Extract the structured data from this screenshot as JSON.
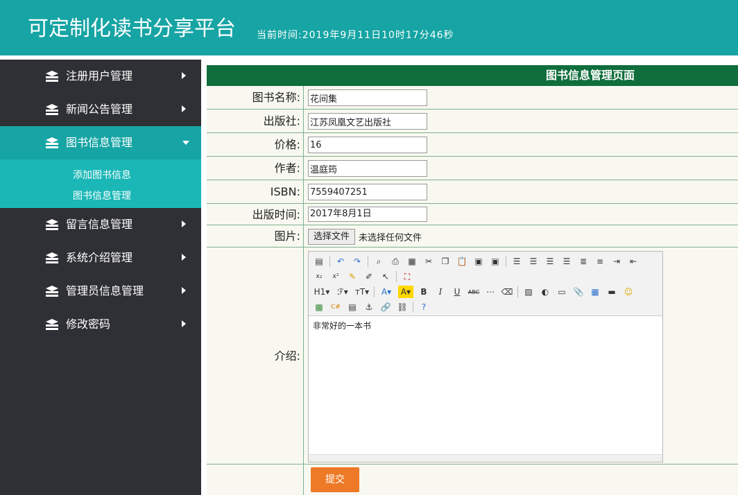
{
  "header": {
    "title": "可定制化读书分享平台",
    "clock": "当前时间:2019年9月11日10时17分46秒"
  },
  "sidebar": {
    "items": [
      {
        "label": "注册用户管理"
      },
      {
        "label": "新闻公告管理"
      },
      {
        "label": "图书信息管理",
        "subitems": [
          "添加图书信息",
          "图书信息管理"
        ]
      },
      {
        "label": "留言信息管理"
      },
      {
        "label": "系统介绍管理"
      },
      {
        "label": "管理员信息管理"
      },
      {
        "label": "修改密码"
      }
    ]
  },
  "panel": {
    "title": "图书信息管理页面"
  },
  "form": {
    "name": {
      "label": "图书名称:",
      "value": "花间集"
    },
    "publisher": {
      "label": "出版社:",
      "value": "江苏凤凰文艺出版社"
    },
    "price": {
      "label": "价格:",
      "value": "16"
    },
    "author": {
      "label": "作者:",
      "value": "温庭筠"
    },
    "isbn": {
      "label": "ISBN:",
      "value": "7559407251"
    },
    "pubdate": {
      "label": "出版时间:",
      "value": "2017年8月1日"
    },
    "image": {
      "label": "图片:",
      "button": "选择文件",
      "note": "未选择任何文件"
    },
    "intro": {
      "label": "介绍:",
      "content": "非常好的一本书"
    },
    "submit": "提交"
  },
  "colors": {
    "header": "#17a4a4",
    "sidebar": "#2f3035",
    "active_item": "#17a4a4",
    "submenu": "#1bb7b7",
    "panel_title": "#0f6e3b",
    "submit": "#ee7a27"
  }
}
